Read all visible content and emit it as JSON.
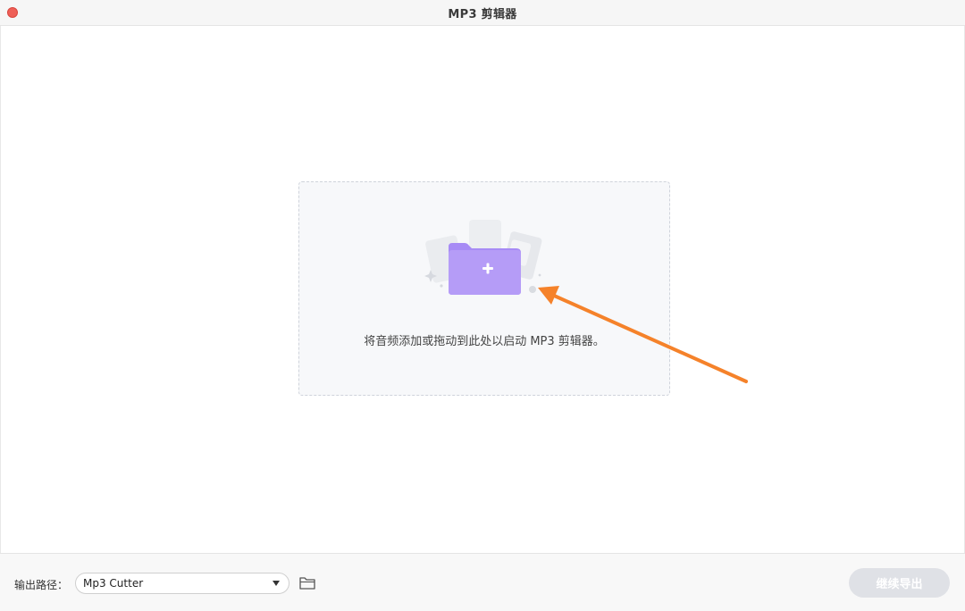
{
  "window": {
    "title": "MP3 剪辑器"
  },
  "dropzone": {
    "hint": "将音频添加或拖动到此处以启动 MP3 剪辑器。"
  },
  "footer": {
    "output_label": "输出路径：",
    "output_path": "Mp3 Cutter",
    "export_label": "继续导出"
  },
  "colors": {
    "accent_purple": "#a78bf5",
    "annotation_arrow": "#f5822a",
    "close_red": "#ee5f57"
  },
  "icons": {
    "close": "close-icon",
    "add_folder": "folder-add-icon",
    "dropdown": "chevron-down-icon",
    "browse_folder": "folder-icon"
  }
}
